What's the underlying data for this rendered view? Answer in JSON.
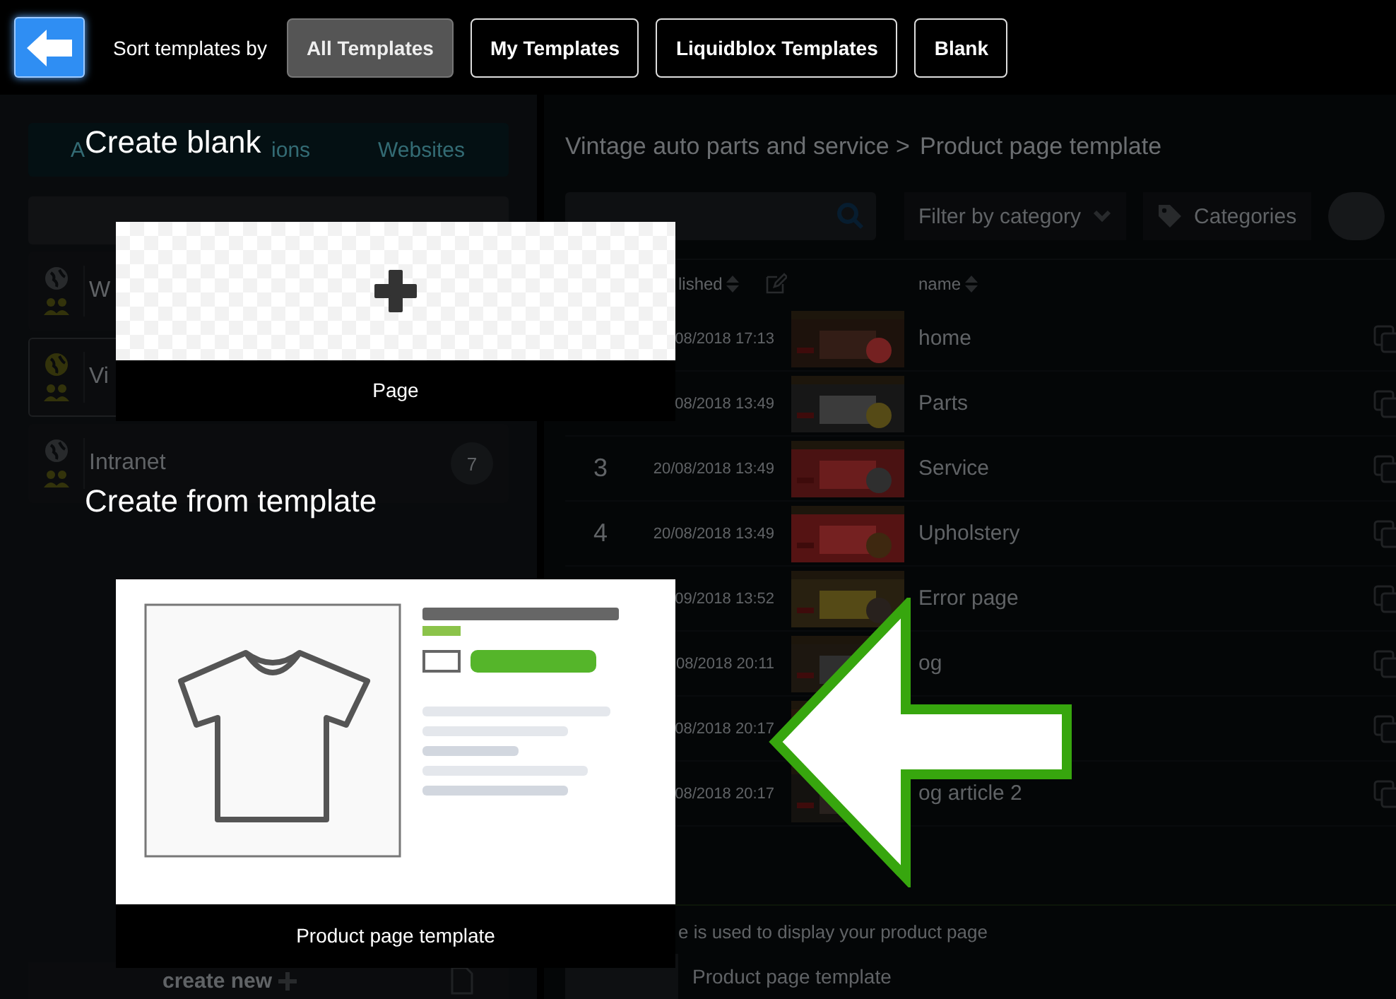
{
  "top_bar": {
    "sort_label": "Sort templates by",
    "filters": [
      {
        "label": "All Templates",
        "selected": true
      },
      {
        "label": "My Templates",
        "selected": false
      },
      {
        "label": "Liquidblox Templates",
        "selected": false
      },
      {
        "label": "Blank",
        "selected": false
      }
    ]
  },
  "sidebar": {
    "tabs": [
      {
        "label": "A",
        "selected": false
      },
      {
        "label": "ions",
        "selected": false
      },
      {
        "label": "Websites",
        "selected": false
      }
    ],
    "sites": [
      {
        "name": "W",
        "selected": false
      },
      {
        "name": "Vi",
        "selected": true
      },
      {
        "name": "Intranet",
        "selected": false,
        "badge": "7"
      }
    ],
    "create_new": "create new"
  },
  "main": {
    "breadcrumb": [
      "Vintage auto parts and service >",
      "Product page template"
    ],
    "filter": "Filter by category",
    "categories": "Categories",
    "columns": [
      "lished",
      "name"
    ],
    "rows": [
      {
        "date": "08/2018 17:13",
        "name": "home"
      },
      {
        "date": "08/2018 13:49",
        "name": "Parts"
      },
      {
        "number": "3",
        "date": "20/08/2018 13:49",
        "name": "Service"
      },
      {
        "number": "4",
        "date": "20/08/2018 13:49",
        "name": "Upholstery"
      },
      {
        "date": "09/2018 13:52",
        "name": "Error page"
      },
      {
        "date": "08/2018 20:11",
        "name": "og"
      },
      {
        "date": "08/2018 20:17"
      },
      {
        "date": "08/2018 20:17",
        "name": "og article 2"
      }
    ],
    "description": "e is used to display your product page",
    "template_name": "Product page template"
  },
  "dialog": {
    "blank_heading": "Create blank",
    "blank_card": "Page",
    "template_heading": "Create from template",
    "template_card": "Product page template"
  }
}
